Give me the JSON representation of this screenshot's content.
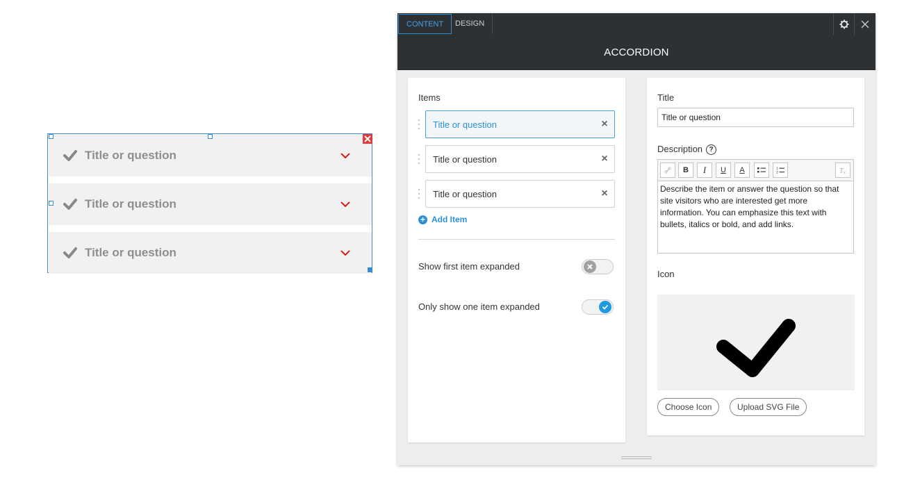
{
  "preview": {
    "rows": [
      {
        "title": "Title or question"
      },
      {
        "title": "Title or question"
      },
      {
        "title": "Title or question"
      }
    ],
    "accent_color": "#e00000"
  },
  "panel": {
    "tabs": {
      "content": "CONTENT",
      "design": "DESIGN"
    },
    "title": "ACCORDION",
    "left": {
      "items_label": "Items",
      "items": [
        {
          "label": "Title or question",
          "selected": true
        },
        {
          "label": "Title or question",
          "selected": false
        },
        {
          "label": "Title or question",
          "selected": false
        }
      ],
      "add_item": "Add Item",
      "show_first_label": "Show first item expanded",
      "show_first_on": false,
      "only_one_label": "Only show one item expanded",
      "only_one_on": true
    },
    "right": {
      "title_label": "Title",
      "title_value": "Title or question",
      "description_label": "Description",
      "description_text": "Describe the item or answer the question so that site visitors who are interested get more information. You can emphasize this text with bullets, italics or bold, and add links.",
      "rte": {
        "bold": "B",
        "italic": "I",
        "underline": "U",
        "color": "A"
      },
      "icon_label": "Icon",
      "choose_icon": "Choose Icon",
      "upload_svg": "Upload SVG File"
    }
  }
}
